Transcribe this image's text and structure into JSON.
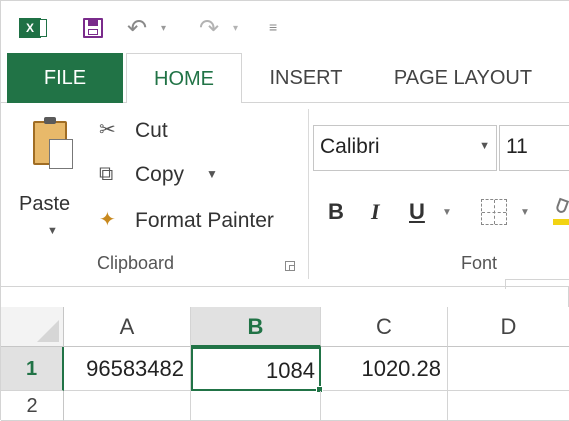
{
  "quick_access": {
    "app_icon": "excel-logo-icon",
    "save_icon": "save-icon",
    "undo_icon": "undo-icon",
    "redo_icon": "redo-icon",
    "customize_icon": "customize-toolbar-icon"
  },
  "tabs": [
    {
      "label": "FILE"
    },
    {
      "label": "HOME"
    },
    {
      "label": "INSERT"
    },
    {
      "label": "PAGE LAYOUT"
    }
  ],
  "active_tab": "HOME",
  "clipboard": {
    "paste_label": "Paste",
    "cut_label": "Cut",
    "copy_label": "Copy",
    "format_painter_label": "Format Painter",
    "group_label": "Clipboard"
  },
  "font": {
    "name": "Calibri",
    "size": "11",
    "bold_label": "B",
    "italic_label": "I",
    "underline_label": "U",
    "group_label": "Font"
  },
  "colors": {
    "accent": "#217346",
    "fill_color": "#f2d313"
  },
  "sheet": {
    "columns": [
      "A",
      "B",
      "C",
      "D"
    ],
    "rows": [
      "1",
      "2"
    ],
    "cells": {
      "A1": "96583482",
      "B1": "1084",
      "C1": "1020.28"
    },
    "selected_cell": "B1"
  }
}
